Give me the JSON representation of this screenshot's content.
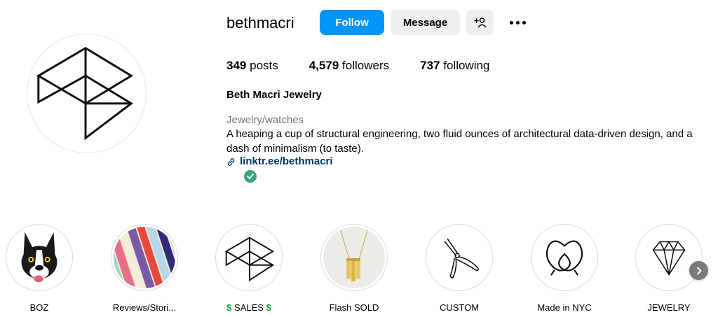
{
  "profile": {
    "username": "bethmacri",
    "follow_label": "Follow",
    "message_label": "Message",
    "stats": {
      "posts_count": "349",
      "posts_label": "posts",
      "followers_count": "4,579",
      "followers_label": "followers",
      "following_count": "737",
      "following_label": "following"
    },
    "full_name": "Beth Macri Jewelry",
    "category": "Jewelry/watches",
    "bio": "A heaping a cup of structural engineering, two fluid ounces of architectural data-driven design, and a dash of minimalism (to taste).",
    "link": "linktr.ee/bethmacri"
  },
  "highlights": [
    {
      "label": "BOZ",
      "icon": "dog"
    },
    {
      "label": "Reviews/Stori...",
      "icon": "rainbow-stripes"
    },
    {
      "label": "SALES",
      "prefix": "$",
      "suffix": "$",
      "icon": "logo-cube"
    },
    {
      "label": "Flash SOLD",
      "icon": "gold-pendant"
    },
    {
      "label": "CUSTOM",
      "icon": "pliers"
    },
    {
      "label": "Made in NYC",
      "icon": "pretzel"
    },
    {
      "label": "JEWELRY",
      "icon": "diamond"
    }
  ],
  "colors": {
    "follow_button": "#0095f6",
    "secondary_button": "#efefef",
    "link": "#00376b",
    "category": "#737373",
    "verified": "#3aa57a",
    "sales_dollar": "#1a9c3e"
  }
}
